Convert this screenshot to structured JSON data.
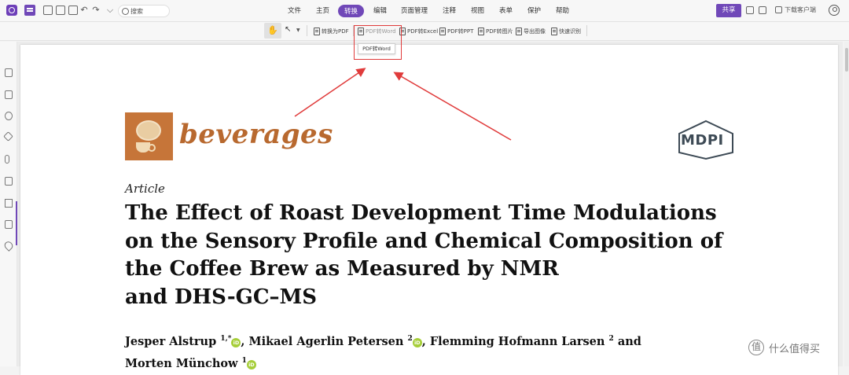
{
  "topbar": {
    "search_placeholder": "搜索",
    "tabs": [
      "文件",
      "主页",
      "转换",
      "编辑",
      "页面管理",
      "注释",
      "视图",
      "表单",
      "保护",
      "帮助"
    ],
    "active_tab": "转换",
    "share_label": "共享",
    "download_label": "下载客户端"
  },
  "toolbar": {
    "tools": [
      "转换为PDF",
      "PDF转Word",
      "PDF转Excel",
      "PDF转PPT",
      "PDF转图片",
      "导出图像",
      "快速识别"
    ],
    "tooltip": "PDF转Word"
  },
  "page": {
    "journal_name": "beverages",
    "publisher": "MDPI",
    "article_type": "Article",
    "title_lines": [
      "The Effect of Roast Development Time Modulations",
      "on the Sensory Profile and Chemical Composition of",
      "the Coffee Brew as Measured by NMR",
      "and DHS-GC–MS"
    ],
    "authors": [
      {
        "name": "Jesper Alstrup",
        "sup": "1,*"
      },
      {
        "name": "Mikael Agerlin Petersen",
        "sup": "2"
      },
      {
        "name": "Flemming Hofmann Larsen",
        "sup": "2"
      },
      {
        "name": "Morten Münchow",
        "sup": "1"
      }
    ],
    "and_word": "and",
    "orcid_label": "iD"
  },
  "watermark": "什么值得买",
  "colors": {
    "accent": "#7048b8",
    "highlight": "#e03b3b",
    "journal": "#b8692f",
    "orcid": "#a6ce39"
  }
}
